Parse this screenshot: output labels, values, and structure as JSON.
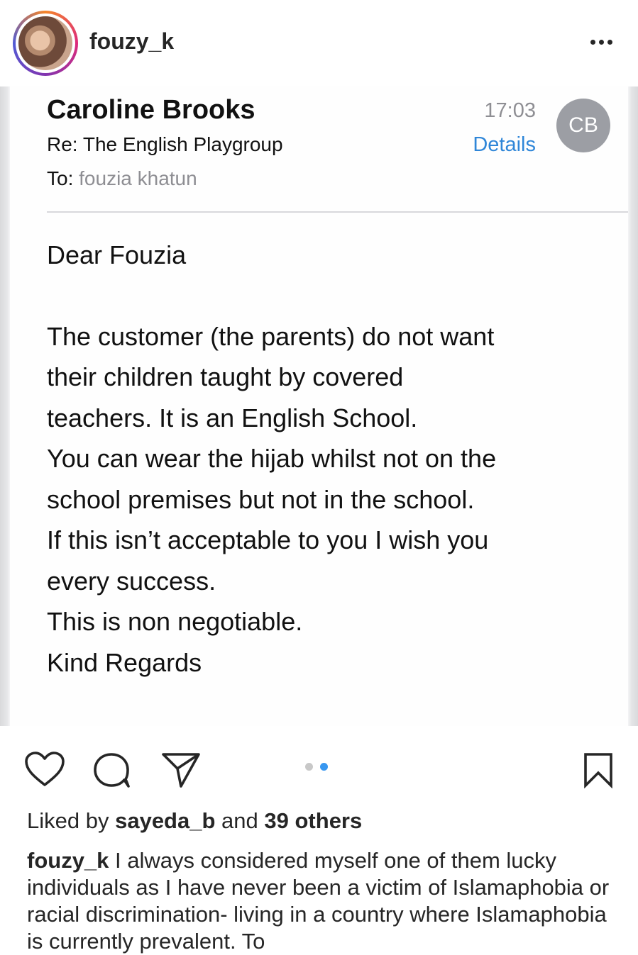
{
  "post": {
    "username": "fouzy_k"
  },
  "email": {
    "sender": "Caroline Brooks",
    "subject": "Re: The English Playgroup",
    "to_label": "To:",
    "to_value": "fouzia khatun",
    "time": "17:03",
    "details_link": "Details",
    "initials": "CB",
    "greeting": "Dear Fouzia",
    "body_lines": [
      "The customer (the parents) do not want",
      "their children taught by covered",
      "teachers.  It is an English School.",
      "You can wear the hijab whilst not on the",
      "school premises but not in the school.",
      "If this isn’t acceptable to you I wish you",
      "every success.",
      "This is non negotiable.",
      "Kind Regards"
    ]
  },
  "actions": {
    "icons": [
      "heart-icon",
      "comment-icon",
      "share-icon",
      "bookmark-icon"
    ],
    "carousel_total": 2,
    "carousel_active_index": 1
  },
  "likes": {
    "prefix": "Liked by",
    "user": "sayeda_b",
    "conjunction": "and",
    "others": "39 others"
  },
  "caption": {
    "user": "fouzy_k",
    "text": "I always considered myself one of them lucky individuals as I have never been a victim of Islamaphobia or racial discrimination- living in a country where Islamaphobia is currently prevalent. To"
  },
  "colors": {
    "link_blue": "#2f86d8",
    "carousel_active": "#3897f0",
    "initials_bg": "#9c9ea4"
  }
}
